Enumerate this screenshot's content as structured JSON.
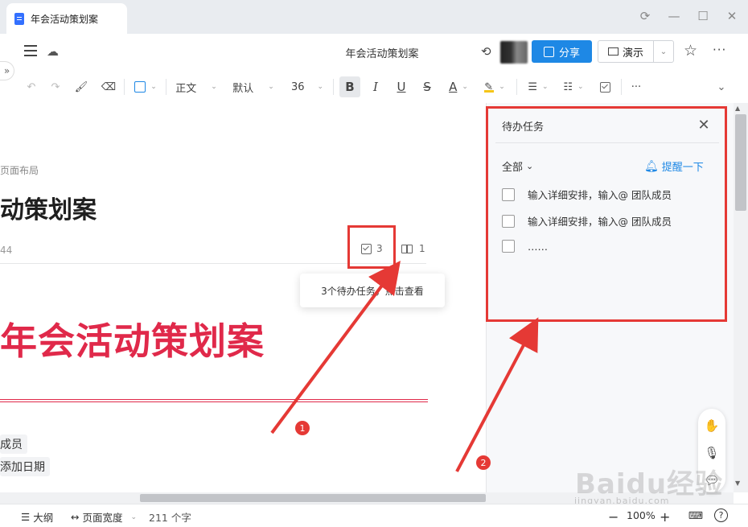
{
  "window": {
    "tab_title": "年会活动策划案"
  },
  "header": {
    "doc_title": "年会活动策划案",
    "share_label": "分享",
    "present_label": "演示"
  },
  "toolbar": {
    "style_value": "正文",
    "font_value": "默认",
    "size_value": "36",
    "bold": "B",
    "italic": "I",
    "underline": "U",
    "strike": "S",
    "font_color": "A",
    "more": "···"
  },
  "document": {
    "breadcrumb": "页面布局",
    "title": "动策划案",
    "meta_number": "44",
    "todo_count": "3",
    "comment_count": "1",
    "tooltip": "3个待办任务，点击查看",
    "heading": "年会活动策划案",
    "pill_1": "成员",
    "pill_2": "添加日期"
  },
  "annotations": {
    "badge_1": "1",
    "badge_2": "2"
  },
  "panel": {
    "title": "待办任务",
    "filter": "全部",
    "remind": "提醒一下",
    "items": [
      "输入详细安排，输入@ 团队成员",
      "输入详细安排，输入@ 团队成员",
      "……"
    ]
  },
  "status": {
    "outline": "大纲",
    "page_width": "页面宽度",
    "word_count": "211 个字",
    "zoom": "100%"
  },
  "watermark": {
    "text": "Baidu经验",
    "sub": "jingyan.baidu.com"
  },
  "colors": {
    "accent": "#1e88e5",
    "heading_red": "#e0294a",
    "annotation_red": "#e53935"
  }
}
